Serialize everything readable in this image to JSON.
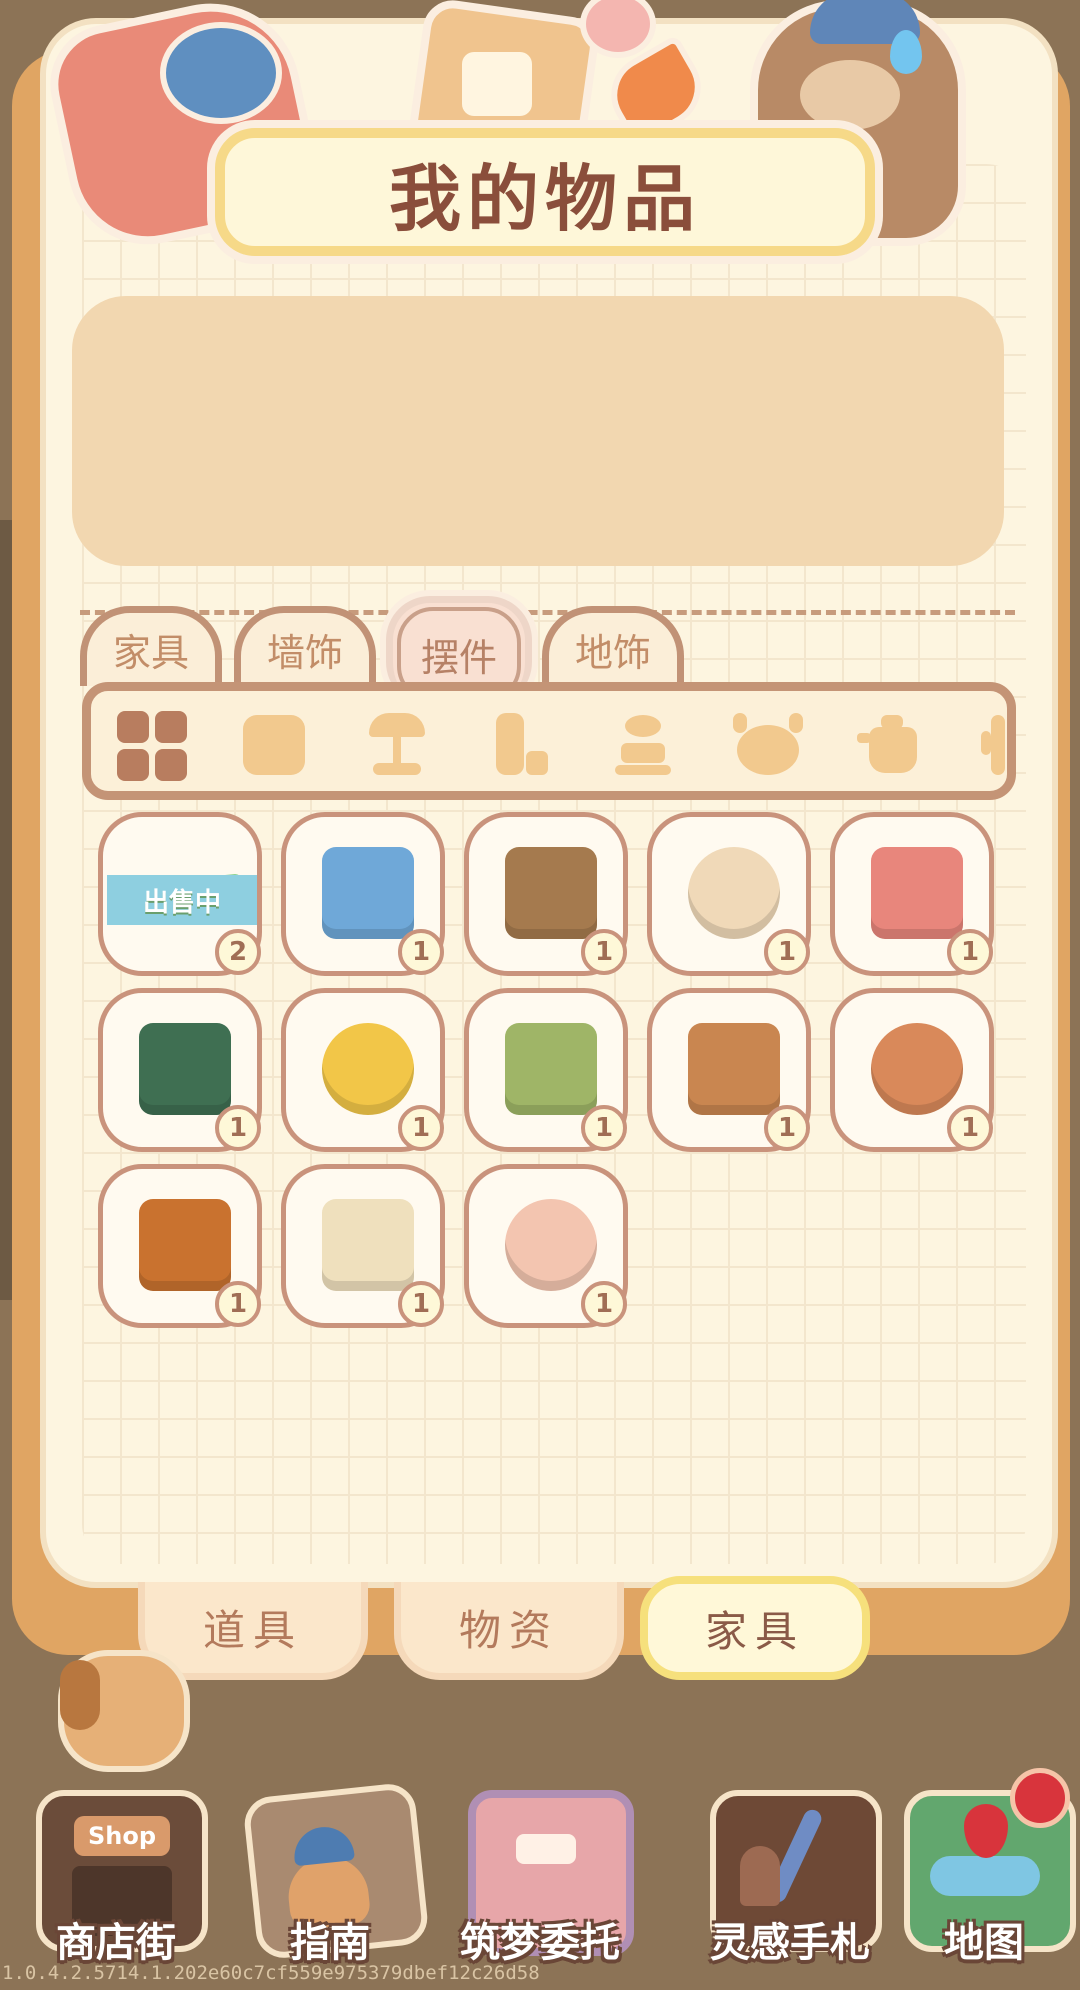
{
  "header": {
    "title": "我的物品"
  },
  "category_tabs": [
    {
      "label": "家具",
      "active": false
    },
    {
      "label": "墙饰",
      "active": false
    },
    {
      "label": "摆件",
      "active": true
    },
    {
      "label": "地饰",
      "active": false
    }
  ],
  "sub_filters": [
    "all-grid-icon",
    "rug-icon",
    "lamp-icon",
    "bottle-icon",
    "plant-icon",
    "cow-icon",
    "kettle-icon",
    "cactus-icon"
  ],
  "items": [
    {
      "name": "sale-item",
      "count": "2",
      "tag": "出售中",
      "color": "#8fd493"
    },
    {
      "name": "fishbowl",
      "count": "1",
      "color": "#6fa8d8"
    },
    {
      "name": "picture-frame",
      "count": "1",
      "color": "#a57a4e"
    },
    {
      "name": "toy-shelf",
      "count": "1",
      "color": "#f0d9b8"
    },
    {
      "name": "tulip-vase",
      "count": "1",
      "color": "#e8867c"
    },
    {
      "name": "bonsai",
      "count": "1",
      "color": "#3f6f52"
    },
    {
      "name": "rubiks-cube",
      "count": "1",
      "color": "#f2c648"
    },
    {
      "name": "oven",
      "count": "1",
      "color": "#9fb567"
    },
    {
      "name": "tea-tray",
      "count": "1",
      "color": "#c98650"
    },
    {
      "name": "snack-tray",
      "count": "1",
      "color": "#d9895a"
    },
    {
      "name": "juice-jug",
      "count": "1",
      "color": "#c9722f"
    },
    {
      "name": "tea-set",
      "count": "1",
      "color": "#efe0bd"
    },
    {
      "name": "toy-basket",
      "count": "1",
      "color": "#f3c5b0"
    }
  ],
  "bottom_tabs": [
    {
      "label": "道具",
      "active": false
    },
    {
      "label": "物资",
      "active": false
    },
    {
      "label": "家具",
      "active": true
    }
  ],
  "nav": [
    {
      "label": "商店街",
      "icon": "shop-icon",
      "sign": "Shop"
    },
    {
      "label": "指南",
      "icon": "guide-book-icon"
    },
    {
      "label": "筑梦委托",
      "icon": "notebook-icon"
    },
    {
      "label": "灵感手札",
      "icon": "journal-icon"
    },
    {
      "label": "地图",
      "icon": "map-icon"
    }
  ],
  "version": "1.0.4.2.5714.1.202e60c7cf559e975379dbef12c26d58"
}
